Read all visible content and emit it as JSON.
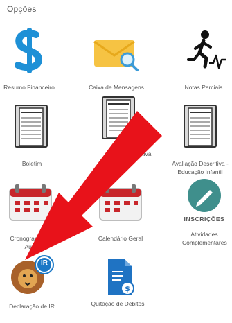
{
  "page": {
    "title": "Opções"
  },
  "tiles": [
    {
      "label": "Resumo Financeiro"
    },
    {
      "label": "Caixa de Mensagens"
    },
    {
      "label": "Notas Parciais"
    },
    {
      "label": "Boletim"
    },
    {
      "label": "Avaliação Semiquantitativa"
    },
    {
      "label": "Avaliação Descritiva - Educação Infantil"
    },
    {
      "label": "Cronograma de Aula"
    },
    {
      "label": "Calendário Geral"
    },
    {
      "label": "Atividades Complementares",
      "badge": "INSCRIÇÕES"
    },
    {
      "label": "Declaração de IR",
      "badge": "IR"
    },
    {
      "label": "Quitação de Débitos"
    }
  ],
  "annotation": {
    "arrow_color": "#e8121a"
  },
  "colors": {
    "dollar": "#1e90d6",
    "envelope": "#f6c343",
    "teal_circle": "#3f8f8c",
    "ir_blue": "#1b78c6",
    "calendar_red": "#c8262b"
  }
}
